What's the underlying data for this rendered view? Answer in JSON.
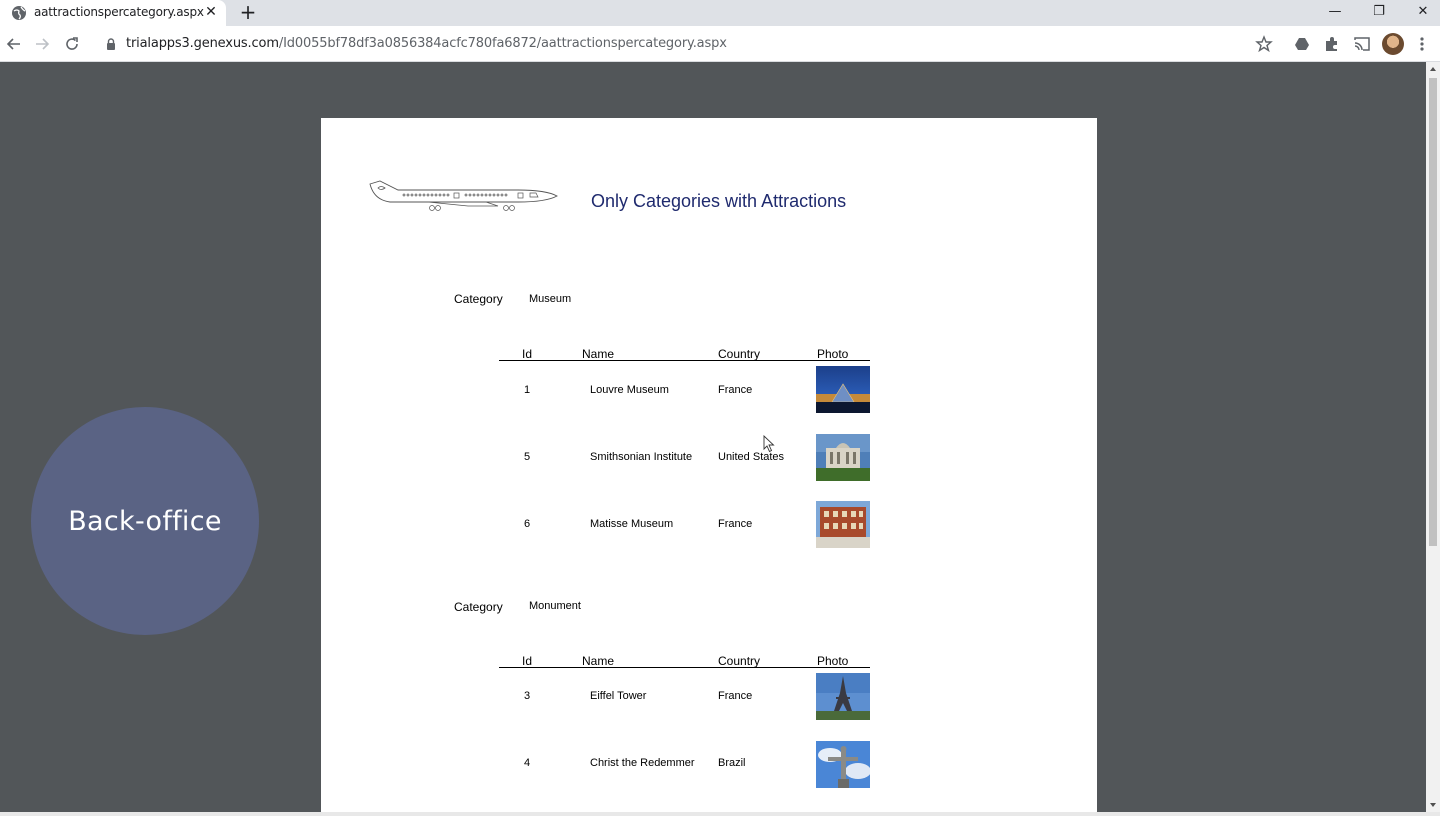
{
  "browser": {
    "tab_title": "aattractionspercategory.aspx",
    "tab_close": "✕",
    "new_tab": "+",
    "url_host": "trialapps3.genexus.com",
    "url_path": "/Id0055bf78df3a0856384acfc780fa6872/aattractionspercategory.aspx",
    "window_minimize": "—",
    "window_restore": "❐",
    "window_close": "✕"
  },
  "report": {
    "title": "Only Categories with Attractions",
    "category_label": "Category",
    "columns": {
      "id": "Id",
      "name": "Name",
      "country": "Country",
      "photo": "Photo"
    },
    "groups": [
      {
        "category": "Museum",
        "rows": [
          {
            "id": "1",
            "name": "Louvre Museum",
            "country": "France",
            "photo": "louvre-photo"
          },
          {
            "id": "5",
            "name": "Smithsonian Institute",
            "country": "United States",
            "photo": "smithsonian-photo"
          },
          {
            "id": "6",
            "name": "Matisse Museum",
            "country": "France",
            "photo": "matisse-photo"
          }
        ]
      },
      {
        "category": "Monument",
        "rows": [
          {
            "id": "3",
            "name": "Eiffel Tower",
            "country": "France",
            "photo": "eiffel-photo"
          },
          {
            "id": "4",
            "name": "Christ the Redemmer",
            "country": "Brazil",
            "photo": "christ-photo"
          }
        ]
      }
    ]
  },
  "overlay": {
    "label": "Back-office"
  }
}
